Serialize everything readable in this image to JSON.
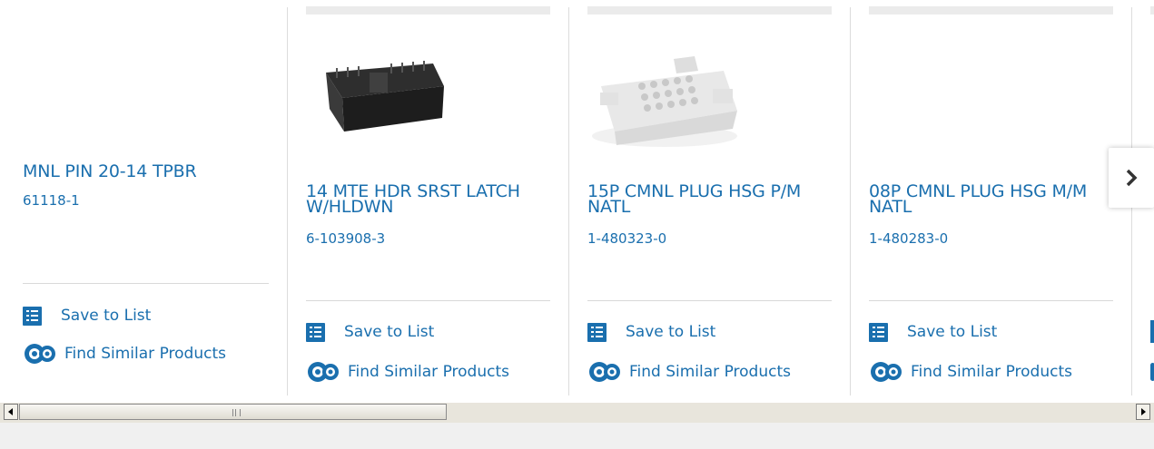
{
  "products": [
    {
      "title": "MNL PIN 20-14 TPBR",
      "part_number": "61118-1",
      "save_label": "Save to List",
      "find_label": "Find Similar Products"
    },
    {
      "title": "14 MTE HDR SRST LATCH W/HLDWN",
      "part_number": "6-103908-3",
      "save_label": "Save to List",
      "find_label": "Find Similar Products"
    },
    {
      "title": "15P CMNL PLUG HSG P/M NATL",
      "part_number": "1-480323-0",
      "save_label": "Save to List",
      "find_label": "Find Similar Products"
    },
    {
      "title": "08P CMNL PLUG HSG M/M NATL",
      "part_number": "1-480283-0",
      "save_label": "Save to List",
      "find_label": "Find Similar Products"
    }
  ],
  "carousel": {
    "next_icon": "chevron-right-icon"
  },
  "colors": {
    "link": "#1a6fae",
    "divider": "#dcdcdc"
  }
}
